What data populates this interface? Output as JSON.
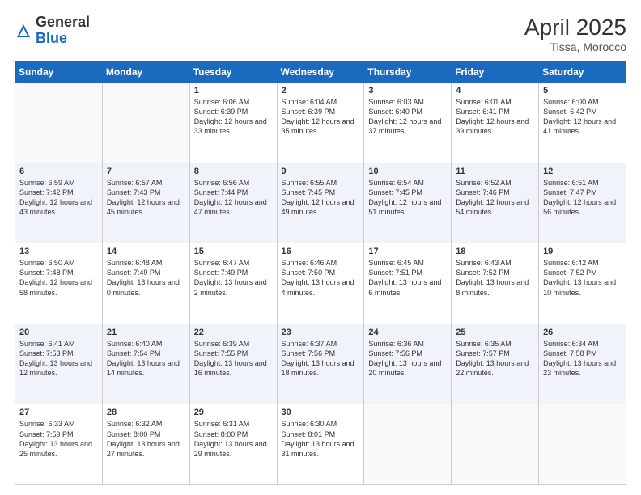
{
  "header": {
    "logo_general": "General",
    "logo_blue": "Blue",
    "month_title": "April 2025",
    "subtitle": "Tissa, Morocco"
  },
  "weekdays": [
    "Sunday",
    "Monday",
    "Tuesday",
    "Wednesday",
    "Thursday",
    "Friday",
    "Saturday"
  ],
  "weeks": [
    [
      {
        "day": "",
        "info": ""
      },
      {
        "day": "",
        "info": ""
      },
      {
        "day": "1",
        "info": "Sunrise: 6:06 AM\nSunset: 6:39 PM\nDaylight: 12 hours and 33 minutes."
      },
      {
        "day": "2",
        "info": "Sunrise: 6:04 AM\nSunset: 6:39 PM\nDaylight: 12 hours and 35 minutes."
      },
      {
        "day": "3",
        "info": "Sunrise: 6:03 AM\nSunset: 6:40 PM\nDaylight: 12 hours and 37 minutes."
      },
      {
        "day": "4",
        "info": "Sunrise: 6:01 AM\nSunset: 6:41 PM\nDaylight: 12 hours and 39 minutes."
      },
      {
        "day": "5",
        "info": "Sunrise: 6:00 AM\nSunset: 6:42 PM\nDaylight: 12 hours and 41 minutes."
      }
    ],
    [
      {
        "day": "6",
        "info": "Sunrise: 6:59 AM\nSunset: 7:42 PM\nDaylight: 12 hours and 43 minutes."
      },
      {
        "day": "7",
        "info": "Sunrise: 6:57 AM\nSunset: 7:43 PM\nDaylight: 12 hours and 45 minutes."
      },
      {
        "day": "8",
        "info": "Sunrise: 6:56 AM\nSunset: 7:44 PM\nDaylight: 12 hours and 47 minutes."
      },
      {
        "day": "9",
        "info": "Sunrise: 6:55 AM\nSunset: 7:45 PM\nDaylight: 12 hours and 49 minutes."
      },
      {
        "day": "10",
        "info": "Sunrise: 6:54 AM\nSunset: 7:45 PM\nDaylight: 12 hours and 51 minutes."
      },
      {
        "day": "11",
        "info": "Sunrise: 6:52 AM\nSunset: 7:46 PM\nDaylight: 12 hours and 54 minutes."
      },
      {
        "day": "12",
        "info": "Sunrise: 6:51 AM\nSunset: 7:47 PM\nDaylight: 12 hours and 56 minutes."
      }
    ],
    [
      {
        "day": "13",
        "info": "Sunrise: 6:50 AM\nSunset: 7:48 PM\nDaylight: 12 hours and 58 minutes."
      },
      {
        "day": "14",
        "info": "Sunrise: 6:48 AM\nSunset: 7:49 PM\nDaylight: 13 hours and 0 minutes."
      },
      {
        "day": "15",
        "info": "Sunrise: 6:47 AM\nSunset: 7:49 PM\nDaylight: 13 hours and 2 minutes."
      },
      {
        "day": "16",
        "info": "Sunrise: 6:46 AM\nSunset: 7:50 PM\nDaylight: 13 hours and 4 minutes."
      },
      {
        "day": "17",
        "info": "Sunrise: 6:45 AM\nSunset: 7:51 PM\nDaylight: 13 hours and 6 minutes."
      },
      {
        "day": "18",
        "info": "Sunrise: 6:43 AM\nSunset: 7:52 PM\nDaylight: 13 hours and 8 minutes."
      },
      {
        "day": "19",
        "info": "Sunrise: 6:42 AM\nSunset: 7:52 PM\nDaylight: 13 hours and 10 minutes."
      }
    ],
    [
      {
        "day": "20",
        "info": "Sunrise: 6:41 AM\nSunset: 7:53 PM\nDaylight: 13 hours and 12 minutes."
      },
      {
        "day": "21",
        "info": "Sunrise: 6:40 AM\nSunset: 7:54 PM\nDaylight: 13 hours and 14 minutes."
      },
      {
        "day": "22",
        "info": "Sunrise: 6:39 AM\nSunset: 7:55 PM\nDaylight: 13 hours and 16 minutes."
      },
      {
        "day": "23",
        "info": "Sunrise: 6:37 AM\nSunset: 7:56 PM\nDaylight: 13 hours and 18 minutes."
      },
      {
        "day": "24",
        "info": "Sunrise: 6:36 AM\nSunset: 7:56 PM\nDaylight: 13 hours and 20 minutes."
      },
      {
        "day": "25",
        "info": "Sunrise: 6:35 AM\nSunset: 7:57 PM\nDaylight: 13 hours and 22 minutes."
      },
      {
        "day": "26",
        "info": "Sunrise: 6:34 AM\nSunset: 7:58 PM\nDaylight: 13 hours and 23 minutes."
      }
    ],
    [
      {
        "day": "27",
        "info": "Sunrise: 6:33 AM\nSunset: 7:59 PM\nDaylight: 13 hours and 25 minutes."
      },
      {
        "day": "28",
        "info": "Sunrise: 6:32 AM\nSunset: 8:00 PM\nDaylight: 13 hours and 27 minutes."
      },
      {
        "day": "29",
        "info": "Sunrise: 6:31 AM\nSunset: 8:00 PM\nDaylight: 13 hours and 29 minutes."
      },
      {
        "day": "30",
        "info": "Sunrise: 6:30 AM\nSunset: 8:01 PM\nDaylight: 13 hours and 31 minutes."
      },
      {
        "day": "",
        "info": ""
      },
      {
        "day": "",
        "info": ""
      },
      {
        "day": "",
        "info": ""
      }
    ]
  ]
}
